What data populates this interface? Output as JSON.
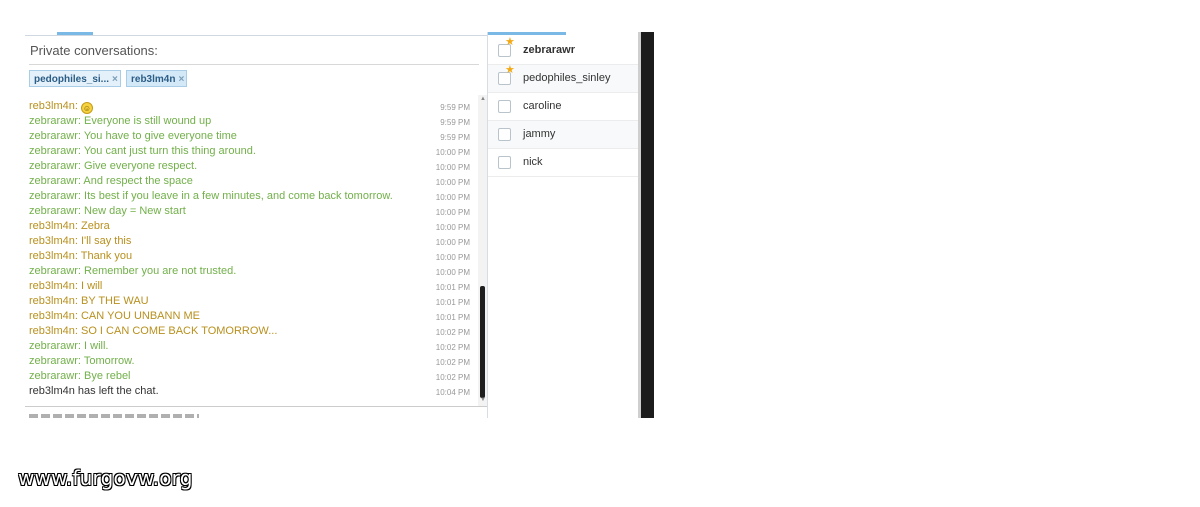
{
  "chat": {
    "title": "Private conversations:",
    "tabs": [
      {
        "label": "pedophiles_si...",
        "close": "×"
      },
      {
        "label": "reb3lm4n",
        "close": "×"
      }
    ],
    "messages": [
      {
        "author": "reb3lm4n",
        "text": "",
        "emoticon": "smile",
        "time": "9:59 PM",
        "kind": "reb"
      },
      {
        "author": "zebrarawr",
        "text": "Everyone is still wound up",
        "time": "9:59 PM",
        "kind": "zeb"
      },
      {
        "author": "zebrarawr",
        "text": "You have to give everyone time",
        "time": "9:59 PM",
        "kind": "zeb"
      },
      {
        "author": "zebrarawr",
        "text": "You cant just turn this thing around.",
        "time": "10:00 PM",
        "kind": "zeb"
      },
      {
        "author": "zebrarawr",
        "text": "Give everyone respect.",
        "time": "10:00 PM",
        "kind": "zeb"
      },
      {
        "author": "zebrarawr",
        "text": "And respect the space",
        "time": "10:00 PM",
        "kind": "zeb"
      },
      {
        "author": "zebrarawr",
        "text": "Its best if you leave in a few minutes, and come back tomorrow.",
        "time": "10:00 PM",
        "kind": "zeb"
      },
      {
        "author": "zebrarawr",
        "text": "New day = New start",
        "time": "10:00 PM",
        "kind": "zeb"
      },
      {
        "author": "reb3lm4n",
        "text": "Zebra",
        "time": "10:00 PM",
        "kind": "reb"
      },
      {
        "author": "reb3lm4n",
        "text": "I'll say this",
        "time": "10:00 PM",
        "kind": "reb"
      },
      {
        "author": "reb3lm4n",
        "text": "Thank you",
        "time": "10:00 PM",
        "kind": "reb"
      },
      {
        "author": "zebrarawr",
        "text": "Remember you are not trusted.",
        "time": "10:00 PM",
        "kind": "zeb"
      },
      {
        "author": "reb3lm4n",
        "text": "I will",
        "time": "10:01 PM",
        "kind": "reb"
      },
      {
        "author": "reb3lm4n",
        "text": "BY THE WAU",
        "time": "10:01 PM",
        "kind": "reb"
      },
      {
        "author": "reb3lm4n",
        "text": "CAN YOU UNBANN ME",
        "time": "10:01 PM",
        "kind": "reb"
      },
      {
        "author": "reb3lm4n",
        "text": "SO I CAN COME BACK TOMORROW...",
        "time": "10:02 PM",
        "kind": "reb"
      },
      {
        "author": "zebrarawr",
        "text": "I will.",
        "time": "10:02 PM",
        "kind": "zeb"
      },
      {
        "author": "zebrarawr",
        "text": "Tomorrow.",
        "time": "10:02 PM",
        "kind": "zeb"
      },
      {
        "author": "zebrarawr",
        "text": "Bye rebel",
        "time": "10:02 PM",
        "kind": "zeb"
      },
      {
        "author": "",
        "text": "reb3lm4n has left the chat.",
        "time": "10:04 PM",
        "kind": "sys"
      }
    ]
  },
  "users": [
    {
      "name": "zebrarawr",
      "starred": true,
      "bold": true
    },
    {
      "name": "pedophiles_sinley",
      "starred": true,
      "bold": false
    },
    {
      "name": "caroline",
      "starred": false,
      "bold": false
    },
    {
      "name": "jammy",
      "starred": false,
      "bold": false
    },
    {
      "name": "nick",
      "starred": false,
      "bold": false
    }
  ],
  "watermark": "www.furgovw.org",
  "colors": {
    "reb": "#b8901e",
    "zeb": "#72b04a",
    "accent": "#7ab8e6",
    "star": "#f2a915"
  },
  "icons": {
    "tab_close": "close-icon",
    "star": "star-icon",
    "checkbox": "checkbox-icon",
    "emoticon": "smiley-icon"
  }
}
